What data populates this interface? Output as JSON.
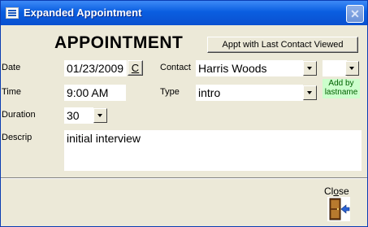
{
  "window": {
    "title": "Expanded Appointment"
  },
  "form": {
    "heading": "APPOINTMENT",
    "appt_button_label": "Appt with Last Contact Viewed",
    "date": {
      "label": "Date",
      "value": "01/23/2009",
      "calendar_button": "C"
    },
    "contact": {
      "label": "Contact",
      "value": "Harris Woods",
      "extra_value": ""
    },
    "add_by_lastname_note": "Add by lastname",
    "time": {
      "label": "Time",
      "value": "9:00 AM"
    },
    "type": {
      "label": "Type",
      "value": "intro"
    },
    "duration": {
      "label": "Duration",
      "value": "30"
    },
    "description": {
      "label": "Descrip",
      "value": "initial interview"
    },
    "close_button": {
      "label": "Close",
      "accesskey": "o"
    }
  },
  "icons": {
    "window": "form-window-icon",
    "close": "exit-door-icon"
  },
  "colors": {
    "titlebar": "#0a5ee0",
    "form_background": "#ece9d8",
    "note_background": "#ccffcc"
  }
}
